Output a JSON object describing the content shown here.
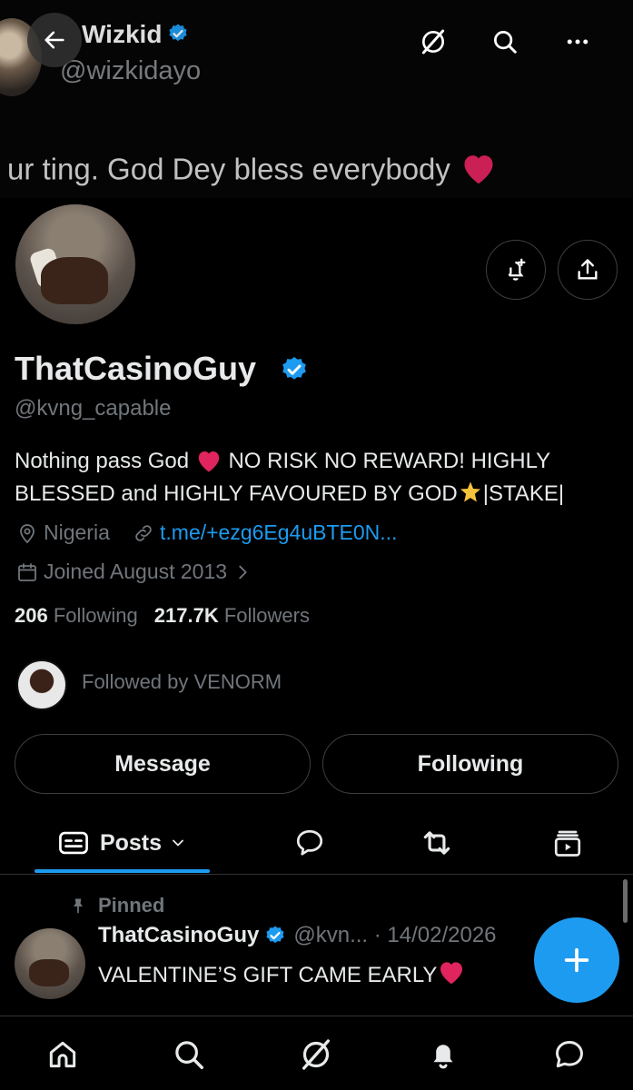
{
  "banner": {
    "name": "Wizkid",
    "handle": "@wizkidayo",
    "tweet_text": "ur ting. God Dey bless everybody"
  },
  "profile": {
    "display_name": "ThatCasinoGuy",
    "handle": "@kvng_capable",
    "bio_part1": "Nothing pass God",
    "bio_part2": "NO RISK NO REWARD! HIGHLY BLESSED and HIGHLY FAVOURED BY GOD",
    "bio_part3": "|STAKE|",
    "location": "Nigeria",
    "link": "t.me/+ezg6Eg4uBTE0N...",
    "joined": "Joined August 2013",
    "following_count": "206",
    "following_label": "Following",
    "followers_count": "217.7K",
    "followers_label": "Followers",
    "followed_by": "Followed by VENORM"
  },
  "actions": {
    "message_label": "Message",
    "following_label": "Following"
  },
  "tabs": {
    "posts_label": "Posts"
  },
  "pinned_tweet": {
    "pinned_label": "Pinned",
    "author": "ThatCasinoGuy",
    "handle_date": "@kvn... · 14/02/2026",
    "text": "VALENTINE’S GIFT CAME EARLY"
  },
  "colors": {
    "accent": "#1d9bf0",
    "background": "#000000",
    "muted": "#71767b",
    "heart": "#e0245e"
  },
  "icons": [
    "back-arrow-icon",
    "grok-icon",
    "search-icon",
    "more-icon",
    "add-notification-icon",
    "share-icon",
    "verified-badge-icon",
    "location-pin-icon",
    "link-icon",
    "calendar-icon",
    "chevron-right-icon",
    "posts-icon",
    "chevron-down-icon",
    "replies-icon",
    "repost-icon",
    "media-icon",
    "pin-icon",
    "plus-icon",
    "home-icon",
    "bell-icon",
    "messages-icon"
  ]
}
